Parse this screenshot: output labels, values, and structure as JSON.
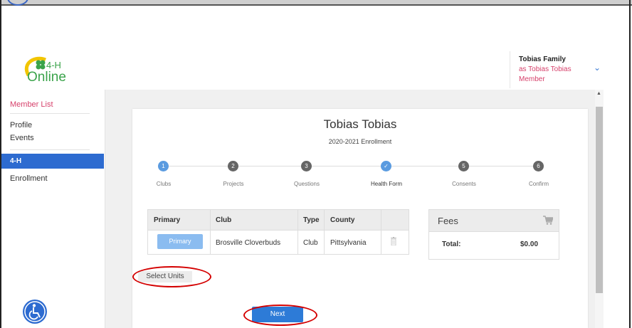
{
  "top_strip": {
    "tiny_text": ""
  },
  "logo": {
    "text": "4-H",
    "sub": "Online",
    "tagline": ""
  },
  "user": {
    "family": "Tobias Family",
    "as_text": "as Tobias Tobias",
    "role": "Member"
  },
  "sidebar": {
    "member_list": "Member List",
    "profile": "Profile",
    "events": "Events",
    "active": "4-H",
    "enrollment": "Enrollment"
  },
  "enrollment": {
    "member_name": "Tobias Tobias",
    "year": "2020-2021 Enrollment",
    "steps": [
      {
        "number": "1",
        "label": "Clubs",
        "state": "done"
      },
      {
        "number": "2",
        "label": "Projects",
        "state": "todo"
      },
      {
        "number": "3",
        "label": "Questions",
        "state": "todo"
      },
      {
        "number": "✓",
        "label": "Health Form",
        "state": "current"
      },
      {
        "number": "5",
        "label": "Consents",
        "state": "todo"
      },
      {
        "number": "6",
        "label": "Confirm",
        "state": "todo"
      }
    ]
  },
  "club_table": {
    "headers": [
      "Primary",
      "Club",
      "Type",
      "County"
    ],
    "row": {
      "primary_button": "Primary",
      "club": "Brosville Cloverbuds",
      "type": "Club",
      "county": "Pittsylvania"
    }
  },
  "fees": {
    "title": "Fees",
    "total_label": "Total:",
    "total_value": "$0.00"
  },
  "actions": {
    "select_units": "Select Units",
    "next": "Next"
  },
  "footer": {
    "tiny_text": ""
  },
  "colors": {
    "accent": "#2d6bd0",
    "pink": "#d6416b",
    "annotation": "#d40000"
  }
}
